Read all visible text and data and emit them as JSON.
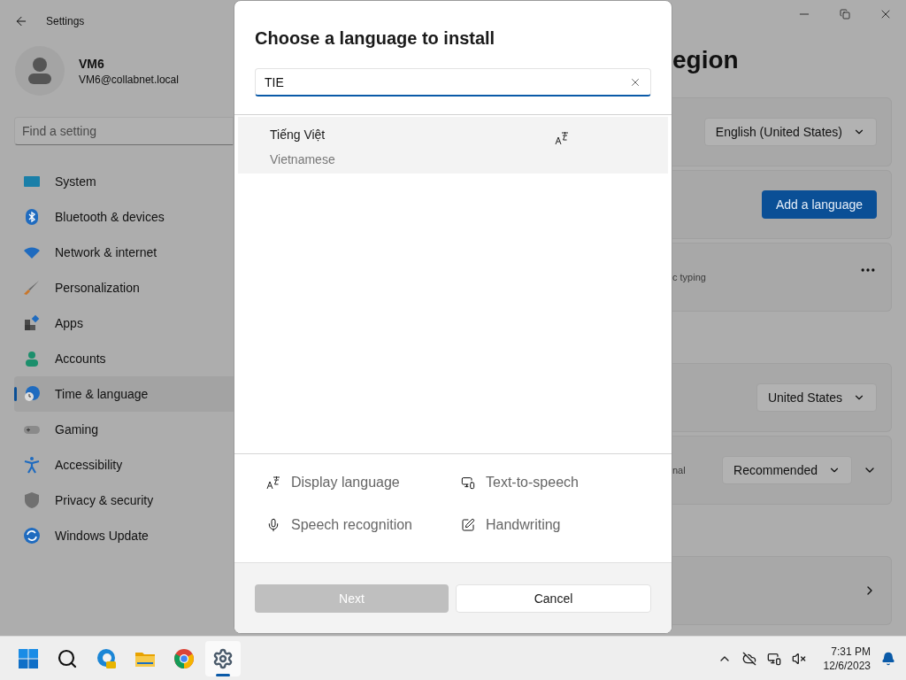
{
  "window": {
    "title": "Settings"
  },
  "account": {
    "name": "VM6",
    "email": "VM6@collabnet.local"
  },
  "search": {
    "placeholder": "Find a setting"
  },
  "sidebar": {
    "items": [
      {
        "kind": "system",
        "label": "System",
        "selected": false
      },
      {
        "kind": "bluetooth",
        "label": "Bluetooth & devices",
        "selected": false
      },
      {
        "kind": "network",
        "label": "Network & internet",
        "selected": false
      },
      {
        "kind": "personalization",
        "label": "Personalization",
        "selected": false
      },
      {
        "kind": "apps",
        "label": "Apps",
        "selected": false
      },
      {
        "kind": "accounts",
        "label": "Accounts",
        "selected": false
      },
      {
        "kind": "time",
        "label": "Time & language",
        "selected": true
      },
      {
        "kind": "gaming",
        "label": "Gaming",
        "selected": false
      },
      {
        "kind": "accessibility",
        "label": "Accessibility",
        "selected": false
      },
      {
        "kind": "privacy",
        "label": "Privacy & security",
        "selected": false
      },
      {
        "kind": "update",
        "label": "Windows Update",
        "selected": false
      }
    ]
  },
  "page": {
    "title": "egion",
    "cards": [
      {
        "kind": "dropdown",
        "text": "English (United States)"
      },
      {
        "kind": "primary",
        "text": "Add a language"
      },
      {
        "kind": "more",
        "caption": "c typing"
      },
      {
        "kind": "dropdown",
        "text": "United States"
      },
      {
        "kind": "dropdown-expand",
        "caption": "nal",
        "text": "Recommended"
      },
      {
        "kind": "link"
      }
    ]
  },
  "dialog": {
    "title": "Choose a language to install",
    "search": {
      "value": "TIE"
    },
    "results": [
      {
        "name": "Tiếng Việt",
        "english": "Vietnamese",
        "selected": true
      }
    ],
    "features": [
      {
        "kind": "display",
        "label": "Display language"
      },
      {
        "kind": "tts",
        "label": "Text-to-speech"
      },
      {
        "kind": "speech",
        "label": "Speech recognition"
      },
      {
        "kind": "handwriting",
        "label": "Handwriting"
      }
    ],
    "buttons": [
      {
        "label": "Next",
        "disabled": true
      },
      {
        "label": "Cancel",
        "disabled": false
      }
    ]
  },
  "taskbar": {
    "apps": [
      {
        "kind": "start",
        "selected": false
      },
      {
        "kind": "search",
        "selected": false
      },
      {
        "kind": "edge",
        "selected": false
      },
      {
        "kind": "explorer",
        "selected": false
      },
      {
        "kind": "chrome",
        "selected": false
      },
      {
        "kind": "settings",
        "selected": true
      }
    ],
    "time": "7:31 PM",
    "date": "12/6/2023"
  }
}
